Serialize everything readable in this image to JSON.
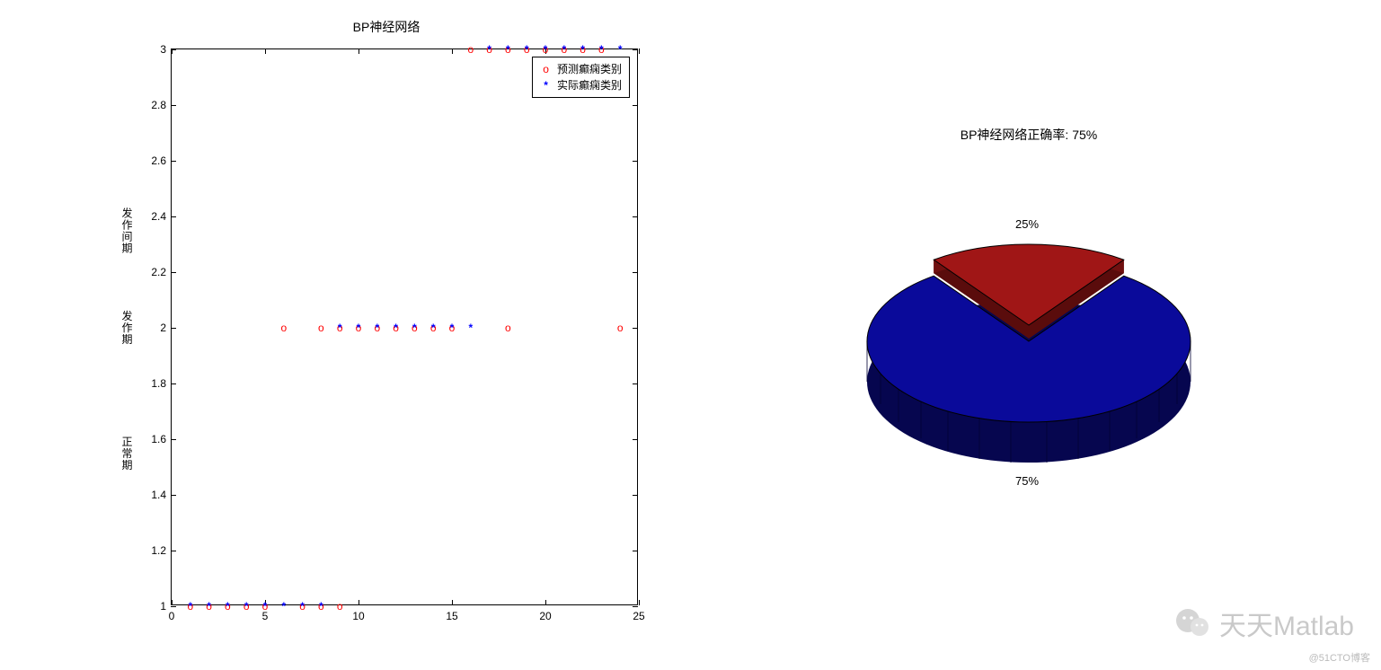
{
  "chart_data": [
    {
      "type": "scatter",
      "title": "BP神经网络",
      "xlim": [
        0,
        25
      ],
      "ylim": [
        1,
        3
      ],
      "xticks": [
        0,
        5,
        10,
        15,
        20,
        25
      ],
      "yticks": [
        1,
        1.2,
        1.4,
        1.6,
        1.8,
        2,
        2.2,
        2.4,
        2.6,
        2.8,
        3
      ],
      "y_category_labels": [
        {
          "y": 1.55,
          "label": "正常期"
        },
        {
          "y": 2.0,
          "label": "发作期"
        },
        {
          "y": 2.35,
          "label": "发作间期"
        }
      ],
      "legend": {
        "position": "top-right-inside",
        "entries": [
          {
            "marker": "o",
            "color": "#ff0000",
            "label": "预测癫痫类别"
          },
          {
            "marker": "*",
            "color": "#0000ff",
            "label": "实际癫痫类别"
          }
        ]
      },
      "series": [
        {
          "name": "预测癫痫类别",
          "marker": "o",
          "color": "#ff0000",
          "points": [
            [
              1,
              1
            ],
            [
              2,
              1
            ],
            [
              3,
              1
            ],
            [
              4,
              1
            ],
            [
              5,
              1
            ],
            [
              7,
              1
            ],
            [
              8,
              1
            ],
            [
              9,
              1
            ],
            [
              6,
              2
            ],
            [
              8,
              2
            ],
            [
              9,
              2
            ],
            [
              10,
              2
            ],
            [
              11,
              2
            ],
            [
              12,
              2
            ],
            [
              13,
              2
            ],
            [
              14,
              2
            ],
            [
              15,
              2
            ],
            [
              18,
              2
            ],
            [
              24,
              2
            ],
            [
              16,
              3
            ],
            [
              17,
              3
            ],
            [
              18,
              3
            ],
            [
              19,
              3
            ],
            [
              20,
              3
            ],
            [
              21,
              3
            ],
            [
              22,
              3
            ],
            [
              23,
              3
            ]
          ]
        },
        {
          "name": "实际癫痫类别",
          "marker": "*",
          "color": "#0000ff",
          "points": [
            [
              1,
              1
            ],
            [
              2,
              1
            ],
            [
              3,
              1
            ],
            [
              4,
              1
            ],
            [
              5,
              1
            ],
            [
              6,
              1
            ],
            [
              7,
              1
            ],
            [
              8,
              1
            ],
            [
              9,
              2
            ],
            [
              10,
              2
            ],
            [
              11,
              2
            ],
            [
              12,
              2
            ],
            [
              13,
              2
            ],
            [
              14,
              2
            ],
            [
              15,
              2
            ],
            [
              16,
              2
            ],
            [
              17,
              3
            ],
            [
              18,
              3
            ],
            [
              19,
              3
            ],
            [
              20,
              3
            ],
            [
              21,
              3
            ],
            [
              22,
              3
            ],
            [
              23,
              3
            ],
            [
              24,
              3
            ]
          ]
        }
      ]
    },
    {
      "type": "pie",
      "title": "BP神经网络正确率: 75%",
      "threeD": true,
      "exploded_index": 0,
      "slices": [
        {
          "label": "25%",
          "value": 25,
          "color": "#a01616"
        },
        {
          "label": "75%",
          "value": 75,
          "color": "#0a0a80"
        }
      ]
    }
  ],
  "watermark": {
    "text": "天天Matlab",
    "credit": "@51CTO博客"
  }
}
